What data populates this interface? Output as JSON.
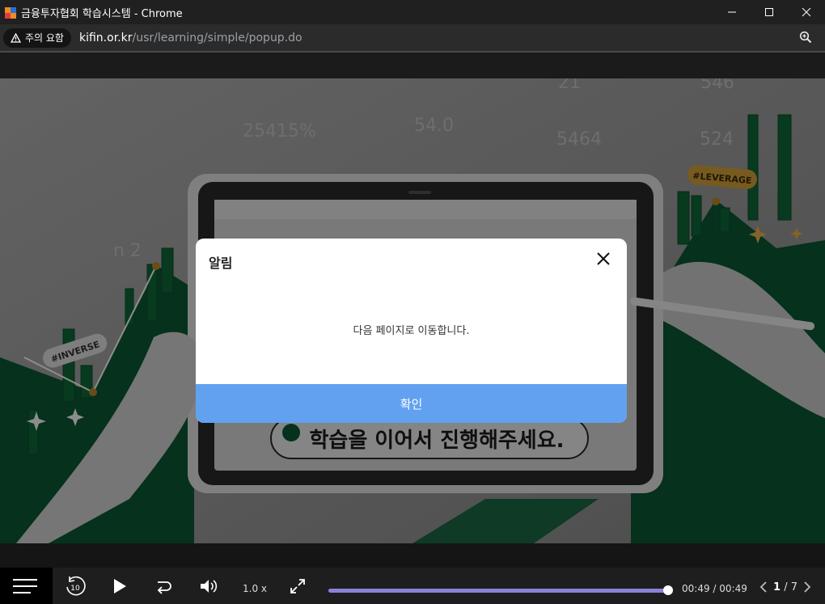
{
  "window": {
    "title": "금융투자협회 학습시스템 - Chrome"
  },
  "address": {
    "warning": "주의 요함",
    "domain": "kifin.or.kr",
    "path": "/usr/learning/simple/popup.do"
  },
  "slide": {
    "ticker_numbers": [
      "25415%",
      "54.0",
      "5464",
      "524",
      "21",
      "546",
      "n 2"
    ],
    "tag_inverse": "#INVERSE",
    "tag_leverage": "#LEVERAGE",
    "banner": "학습을 이어서 진행해주세요."
  },
  "modal": {
    "title": "알림",
    "message": "다음 페이지로 이동합니다.",
    "ok_label": "확인"
  },
  "player": {
    "speed": "1.0 x",
    "time": "00:49 / 00:49",
    "progress": 1.0,
    "page_current": "1",
    "page_sep": "/",
    "page_total": "7",
    "rewind_seconds": "10"
  },
  "colors": {
    "accent": "#62a1f0",
    "progress": "#8a82d6",
    "green": "#0b5a33"
  }
}
